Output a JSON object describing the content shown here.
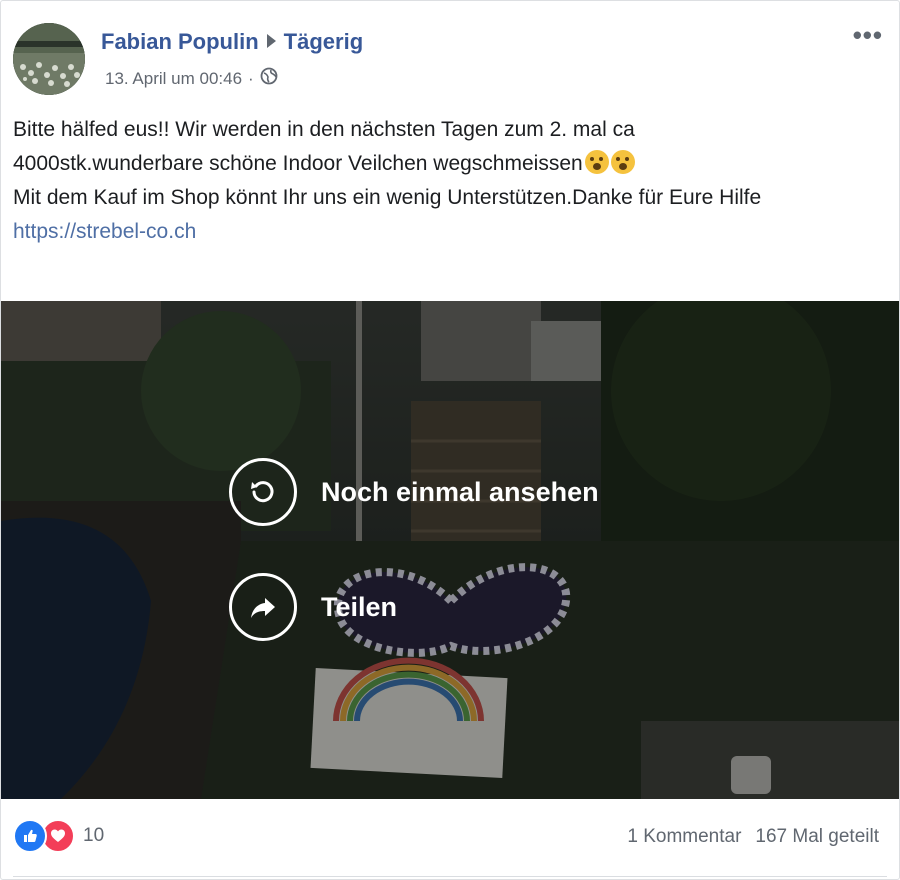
{
  "post": {
    "author": "Fabian Populin",
    "feeling": "Tägerig",
    "timestamp": "13. April um 00:46",
    "separator": "·",
    "privacy_icon": "globe-icon",
    "more_label": "•••",
    "text_line1": "Bitte hälfed eus!! Wir werden in den nächsten Tagen zum 2. mal ca",
    "text_line2": "4000stk.wunderbare schöne Indoor Veilchen wegschmeissen",
    "text_line3": "Mit dem Kauf im Shop könnt Ihr uns ein wenig Unterstützen.Danke für Eure Hilfe",
    "link": "https://strebel-co.ch",
    "emojis": [
      "crying-face-icon",
      "crying-face-icon"
    ]
  },
  "video": {
    "replay_label": "Noch einmal ansehen",
    "share_label": "Teilen",
    "replay_icon": "replay-icon",
    "share_icon": "share-arrow-icon"
  },
  "footer": {
    "reaction_count": "10",
    "comments": "1 Kommentar",
    "shares": "167 Mal geteilt",
    "reaction_icons": [
      "like-icon",
      "love-icon"
    ]
  },
  "colors": {
    "author": "#385898",
    "like": "#2078f4",
    "love": "#f33e58",
    "link": "#4f6fa5"
  }
}
